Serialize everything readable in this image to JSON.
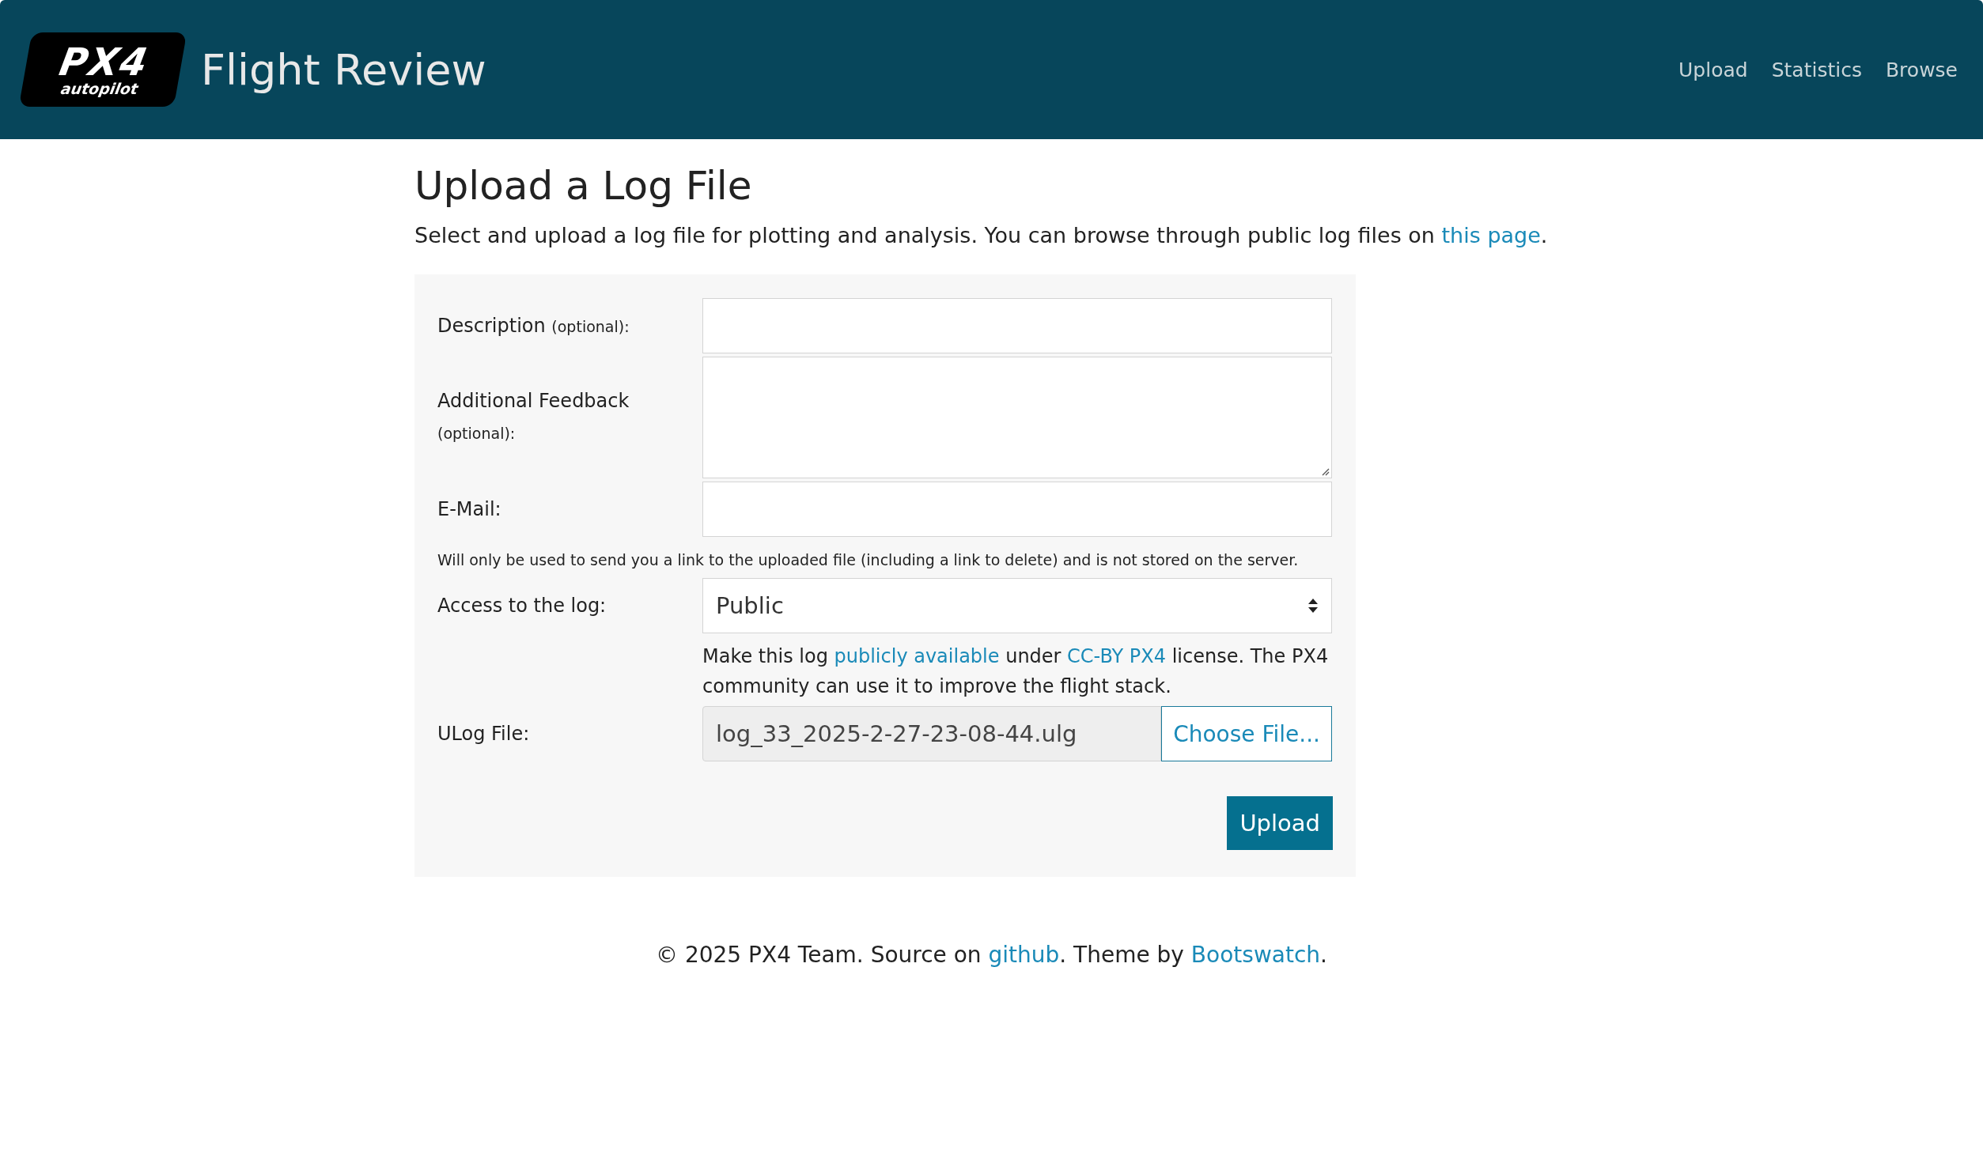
{
  "navbar": {
    "logo_main": "PX4",
    "logo_sub": "autopilot",
    "title": "Flight Review",
    "links": [
      "Upload",
      "Statistics",
      "Browse"
    ]
  },
  "page": {
    "heading": "Upload a Log File",
    "intro": [
      {
        "kind": "text",
        "text": "Select and upload a log file for plotting and analysis. You can browse through public log files on "
      },
      {
        "kind": "link",
        "text": "this page"
      },
      {
        "kind": "text",
        "text": "."
      }
    ]
  },
  "form": {
    "description": {
      "label": "Description",
      "note": "(optional):"
    },
    "feedback": {
      "label": "Additional Feedback",
      "note": "(optional):"
    },
    "email": {
      "label": "E-Mail:",
      "help": "Will only be used to send you a link to the uploaded file (including a link to delete) and is not stored on the server."
    },
    "access": {
      "label": "Access to the log:",
      "value": "Public",
      "help": [
        {
          "kind": "text",
          "text": "Make this log "
        },
        {
          "kind": "link",
          "text": "publicly available"
        },
        {
          "kind": "text",
          "text": " under "
        },
        {
          "kind": "link",
          "text": "CC-BY PX4"
        },
        {
          "kind": "text",
          "text": " license. The PX4 community can use it to improve the flight stack."
        }
      ]
    },
    "file": {
      "label": "ULog File:",
      "value": "log_33_2025-2-27-23-08-44.ulg",
      "button": "Choose File..."
    },
    "submit": "Upload"
  },
  "footer": [
    {
      "kind": "text",
      "text": "© 2025 PX4 Team. Source on "
    },
    {
      "kind": "link",
      "text": "github"
    },
    {
      "kind": "text",
      "text": ". Theme by "
    },
    {
      "kind": "link",
      "text": "Bootswatch"
    },
    {
      "kind": "text",
      "text": "."
    }
  ]
}
